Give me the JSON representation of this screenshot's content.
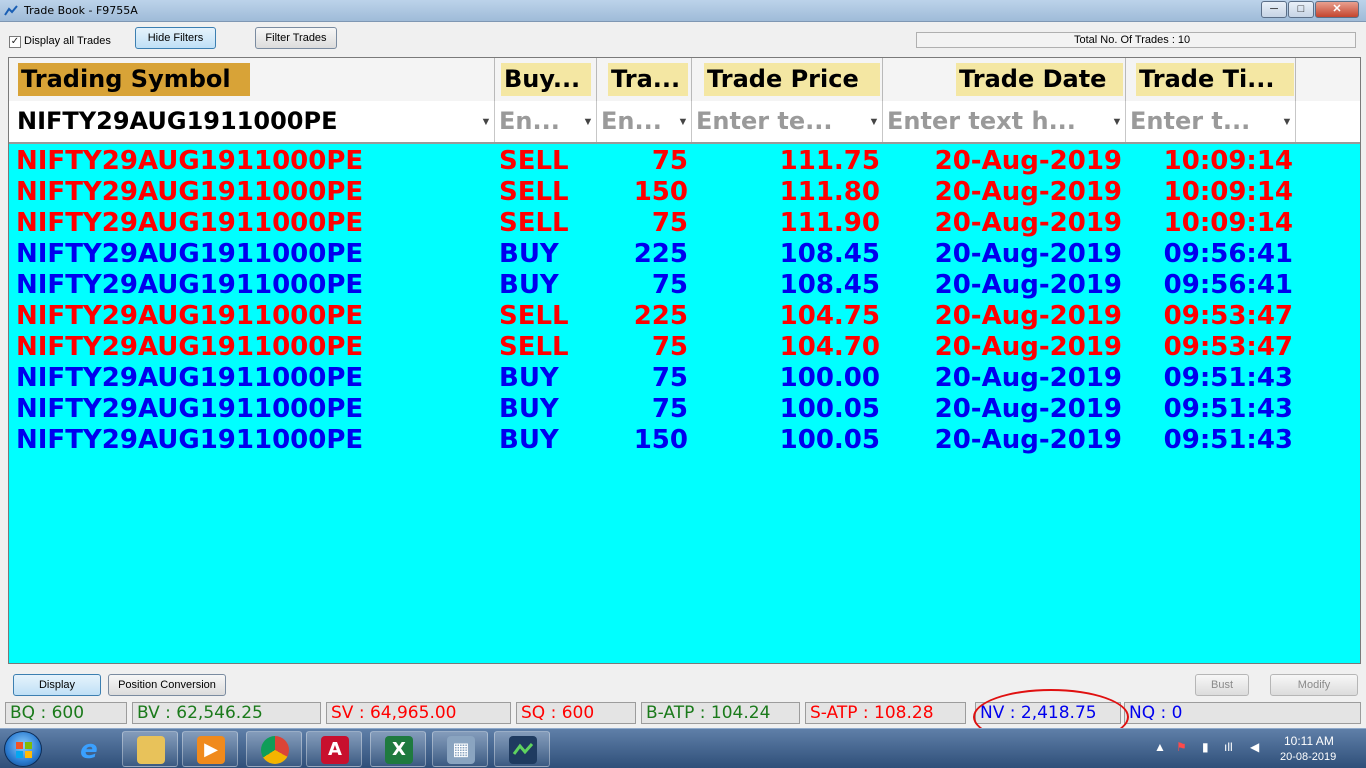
{
  "window": {
    "title": "Trade Book - F9755A",
    "minimize": "─",
    "maximize": "□",
    "close": "✕"
  },
  "toolbar": {
    "display_all_checked": "✓",
    "display_all_label": "Display all Trades",
    "hide_filters": "Hide Filters",
    "filter_trades": "Filter Trades",
    "total_trades": "Total No. Of Trades : 10"
  },
  "grid": {
    "headers": [
      "Trading Symbol",
      "Buy...",
      "Tra...",
      "Trade Price",
      "Trade Date",
      "Trade Ti..."
    ],
    "filters": {
      "symbol_value": "NIFTY29AUG1911000PE",
      "buy_placeholder": "En...",
      "qty_placeholder": "En...",
      "price_placeholder": "Enter te...",
      "date_placeholder": "Enter text h...",
      "time_placeholder": "Enter t..."
    },
    "filter_icon": "funnel-icon",
    "rows": [
      {
        "symbol": "NIFTY29AUG1911000PE",
        "side": "SELL",
        "qty": "75",
        "price": "111.75",
        "date": "20-Aug-2019",
        "time": "10:09:14"
      },
      {
        "symbol": "NIFTY29AUG1911000PE",
        "side": "SELL",
        "qty": "150",
        "price": "111.80",
        "date": "20-Aug-2019",
        "time": "10:09:14"
      },
      {
        "symbol": "NIFTY29AUG1911000PE",
        "side": "SELL",
        "qty": "75",
        "price": "111.90",
        "date": "20-Aug-2019",
        "time": "10:09:14"
      },
      {
        "symbol": "NIFTY29AUG1911000PE",
        "side": "BUY",
        "qty": "225",
        "price": "108.45",
        "date": "20-Aug-2019",
        "time": "09:56:41"
      },
      {
        "symbol": "NIFTY29AUG1911000PE",
        "side": "BUY",
        "qty": "75",
        "price": "108.45",
        "date": "20-Aug-2019",
        "time": "09:56:41"
      },
      {
        "symbol": "NIFTY29AUG1911000PE",
        "side": "SELL",
        "qty": "225",
        "price": "104.75",
        "date": "20-Aug-2019",
        "time": "09:53:47"
      },
      {
        "symbol": "NIFTY29AUG1911000PE",
        "side": "SELL",
        "qty": "75",
        "price": "104.70",
        "date": "20-Aug-2019",
        "time": "09:53:47"
      },
      {
        "symbol": "NIFTY29AUG1911000PE",
        "side": "BUY",
        "qty": "75",
        "price": "100.00",
        "date": "20-Aug-2019",
        "time": "09:51:43"
      },
      {
        "symbol": "NIFTY29AUG1911000PE",
        "side": "BUY",
        "qty": "75",
        "price": "100.05",
        "date": "20-Aug-2019",
        "time": "09:51:43"
      },
      {
        "symbol": "NIFTY29AUG1911000PE",
        "side": "BUY",
        "qty": "150",
        "price": "100.05",
        "date": "20-Aug-2019",
        "time": "09:51:43"
      }
    ]
  },
  "actions": {
    "display": "Display",
    "position_conversion": "Position Conversion",
    "bust": "Bust",
    "modify": "Modify"
  },
  "summary": {
    "bq": "BQ : 600",
    "bv": "BV : 62,546.25",
    "sv": "SV : 64,965.00",
    "sq": "SQ : 600",
    "batp": "B-ATP : 104.24",
    "satp": "S-ATP : 108.28",
    "nv": "NV : 2,418.75",
    "nq": "NQ : 0"
  },
  "colors": {
    "grid_bg": "#00ffff",
    "sell": "#ff0000",
    "buy": "#0000ee",
    "active_header": "#d8a337",
    "header": "#f4e7a3"
  },
  "taskbar": {
    "apps": [
      "ie-icon",
      "explorer-icon",
      "media-player-icon",
      "chrome-icon",
      "pdf-icon",
      "excel-icon",
      "calculator-icon",
      "trading-app-icon"
    ],
    "pdf_glyph": "A",
    "excel_glyph": "X",
    "calc_glyph": "▦",
    "ie_glyph": "e",
    "tray": {
      "show_hidden": "▲",
      "flag": "⚑",
      "network": "▮",
      "signal": "ıll",
      "volume": "◀"
    },
    "clock_time": "10:11 AM",
    "clock_date": "20-08-2019"
  }
}
